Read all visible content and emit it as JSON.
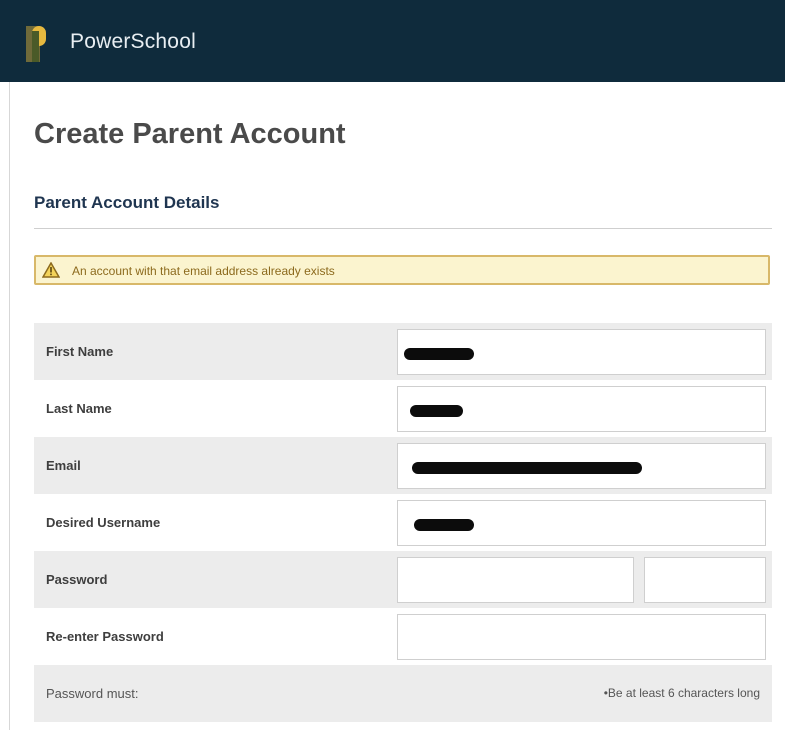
{
  "header": {
    "brand": "PowerSchool",
    "bg_color": "#0f2b3c",
    "logo_icon": "powerschool-logo-icon"
  },
  "page": {
    "title": "Create Parent Account",
    "section_title": "Parent Account Details"
  },
  "alert": {
    "icon": "warning-icon",
    "message": "An account with that email address already exists",
    "bg_color": "#fbf4cf",
    "border_color": "#d8b869"
  },
  "form": {
    "first_name": {
      "label": "First Name"
    },
    "last_name": {
      "label": "Last Name"
    },
    "email": {
      "label": "Email"
    },
    "username": {
      "label": "Desired Username"
    },
    "password": {
      "label": "Password"
    },
    "reenter_password": {
      "label": "Re-enter Password"
    },
    "password_rules": {
      "label": "Password must:",
      "rule": "•Be at least 6 characters long"
    }
  }
}
